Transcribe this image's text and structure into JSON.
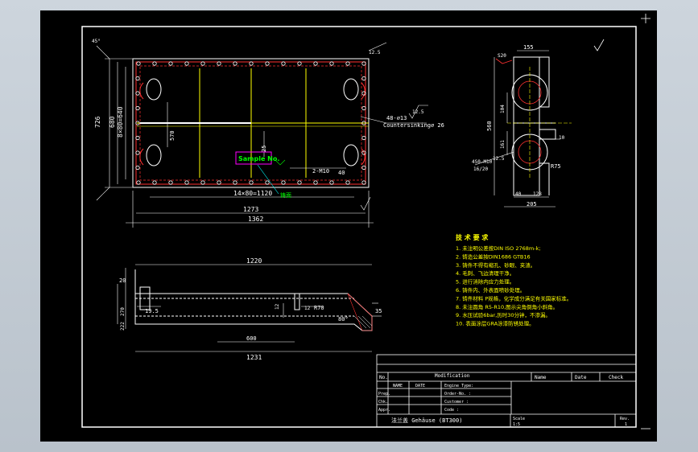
{
  "plan_view": {
    "dim_1362": "1362",
    "dim_1273": "1273",
    "dim_14x80": "14×80=1120",
    "dim_726": "726",
    "dim_570": "570",
    "dim_8x80": "8×80=640",
    "dim_680": "680",
    "dim_25": "25",
    "dim_40": "40",
    "dim_2m10": "2-M10",
    "hole_note": "48-⌀13",
    "countersink_note": "Countersinking⌀ 26",
    "finish_12_5a": "12.5",
    "finish_12_5b": "12.5",
    "tag_sample": "Sample No.",
    "tag_casting": "铸面",
    "angle_45": "45°"
  },
  "side_view": {
    "dim_155": "155",
    "dim_560": "560",
    "dim_104": "104",
    "dim_161": "161",
    "dim_10": "10",
    "dim_r75": "R75",
    "dim_40": "40",
    "dim_128": "128",
    "dim_205": "205",
    "dim_s20": "S20",
    "thread_note": "4S0-M10",
    "depth_note": "16/20",
    "finish": "12.5"
  },
  "section_view": {
    "dim_1220": "1220",
    "dim_1231": "1231",
    "dim_600": "600",
    "dim_20": "20",
    "dim_19_5": "19.5",
    "dim_12a": "12",
    "dim_12b": "12",
    "dim_r70": "R70",
    "dim_35": "35",
    "dim_80": "80°",
    "dim_270": "270",
    "dim_222": "222"
  },
  "tech_req": {
    "title": "技 术 要 求",
    "items": [
      "1. 未注明公差按DIN ISO 2768m-k;",
      "2. 铸造公差按DIN1686 GTB16",
      "3. 铸件不得有缩孔、砂眼、夹渣。",
      "4. 毛刺、飞边清理干净。",
      "5. 进行消除内应力处理。",
      "6. 铸件内、外表面喷砂处理。",
      "7. 铸件材料 P规格，化学成分满足有关国家标准。",
      "8. 未注圆角 R5-R10,图示尖角倒角小斜角。",
      "9. 水压试验6bar,历时30分钟，不渗漏。",
      "10. 表面涂层GRA涂漆防锈处理。"
    ]
  },
  "title_block": {
    "no": "No.",
    "modification": "Modification",
    "name": "Name",
    "date": "Date",
    "check": "Check",
    "name2": "NAME",
    "date2": "DATE",
    "engine_type": "Engine Type:",
    "order_no": "Order-No. :",
    "customer": "Customer  :",
    "code": "Code      :",
    "prep": "Prep.",
    "chk": "Chk.",
    "appr": "Appr.",
    "drawing_title": "法兰盖 Gehäuse (BT300)",
    "scale_label": "Scale",
    "scale_value": "1:5",
    "rev_label": "Rev.",
    "rev_value": "1"
  }
}
